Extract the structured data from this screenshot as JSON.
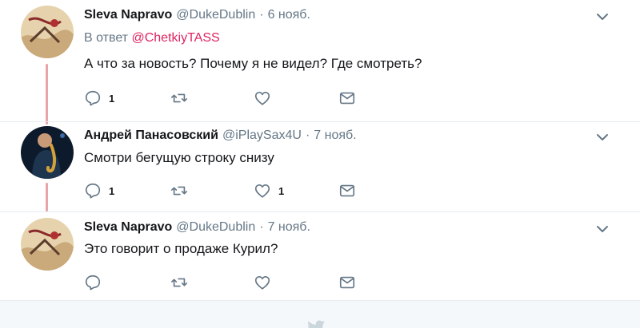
{
  "tweets": [
    {
      "name": "Sleva Napravo",
      "handle": "@DukeDublin",
      "separator": "·",
      "time": "6 нояб.",
      "reply_prefix": "В ответ",
      "reply_mention": "@ChetkiyTASS",
      "text": "А что за новость? Почему я не видел? Где смотреть?",
      "reply_count": "1",
      "retweet_count": "",
      "like_count": ""
    },
    {
      "name": "Андрей Панасовский",
      "handle": "@iPlaySax4U",
      "separator": "·",
      "time": "7 нояб.",
      "text": "Смотри бегущую строку снизу",
      "reply_count": "1",
      "retweet_count": "",
      "like_count": "1"
    },
    {
      "name": "Sleva Napravo",
      "handle": "@DukeDublin",
      "separator": "·",
      "time": "7 нояб.",
      "text": "Это говорит о продаже Курил?",
      "reply_count": "",
      "retweet_count": "",
      "like_count": ""
    }
  ],
  "icons": {
    "reply": "reply-icon",
    "retweet": "retweet-icon",
    "like": "heart-icon",
    "dm": "envelope-icon",
    "caret": "chevron-down-icon",
    "footer": "twitter-bird-icon"
  },
  "colors": {
    "text": "#14171a",
    "secondary": "#657786",
    "mention": "#e0245e",
    "thread_line": "#e8a3ab",
    "divider": "#e6ecf0",
    "footer_bg": "#f5f8fa",
    "icon_bird": "#ccd6dd"
  }
}
